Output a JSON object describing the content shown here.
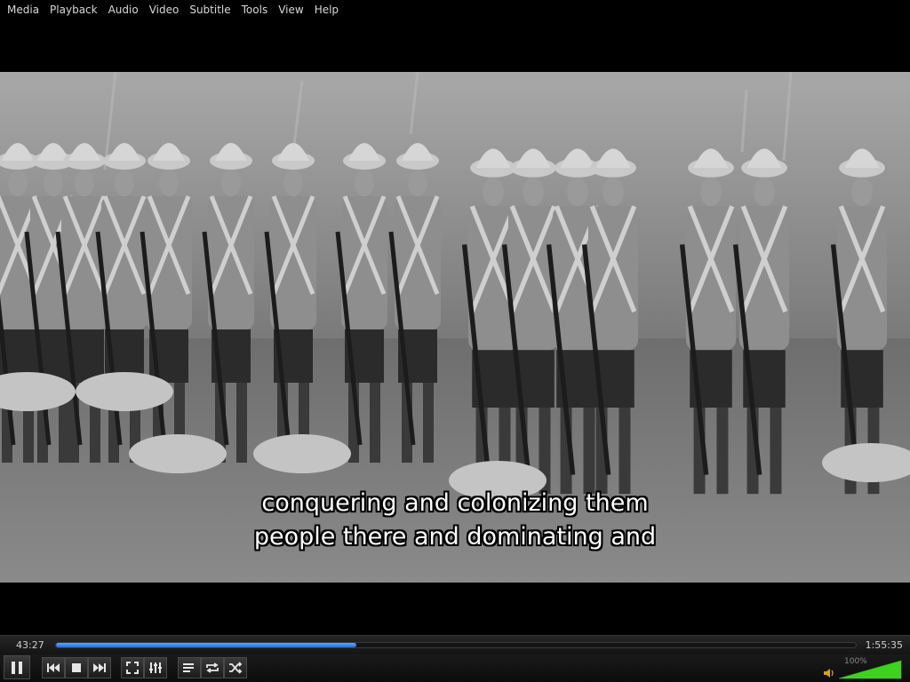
{
  "menu": [
    "Media",
    "Playback",
    "Audio",
    "Video",
    "Subtitle",
    "Tools",
    "View",
    "Help"
  ],
  "subtitles": {
    "line1": "conquering and colonizing them",
    "line2": "people there and dominating and"
  },
  "seek": {
    "elapsed": "43:27",
    "total": "1:55:35",
    "progress": 0.376
  },
  "volume": {
    "label": "100%",
    "level": 1.0
  },
  "icons": {
    "pause": "pause-icon",
    "previous": "skip-previous-icon",
    "stop": "stop-icon",
    "next": "skip-next-icon",
    "fullscreen": "fullscreen-icon",
    "extended": "equalizer-icon",
    "playlist": "playlist-icon",
    "loop": "loop-icon",
    "random": "shuffle-icon",
    "volume": "speaker-icon"
  },
  "colors": {
    "accent": "#2a7fe8",
    "volume_green": "#3cd21e"
  }
}
